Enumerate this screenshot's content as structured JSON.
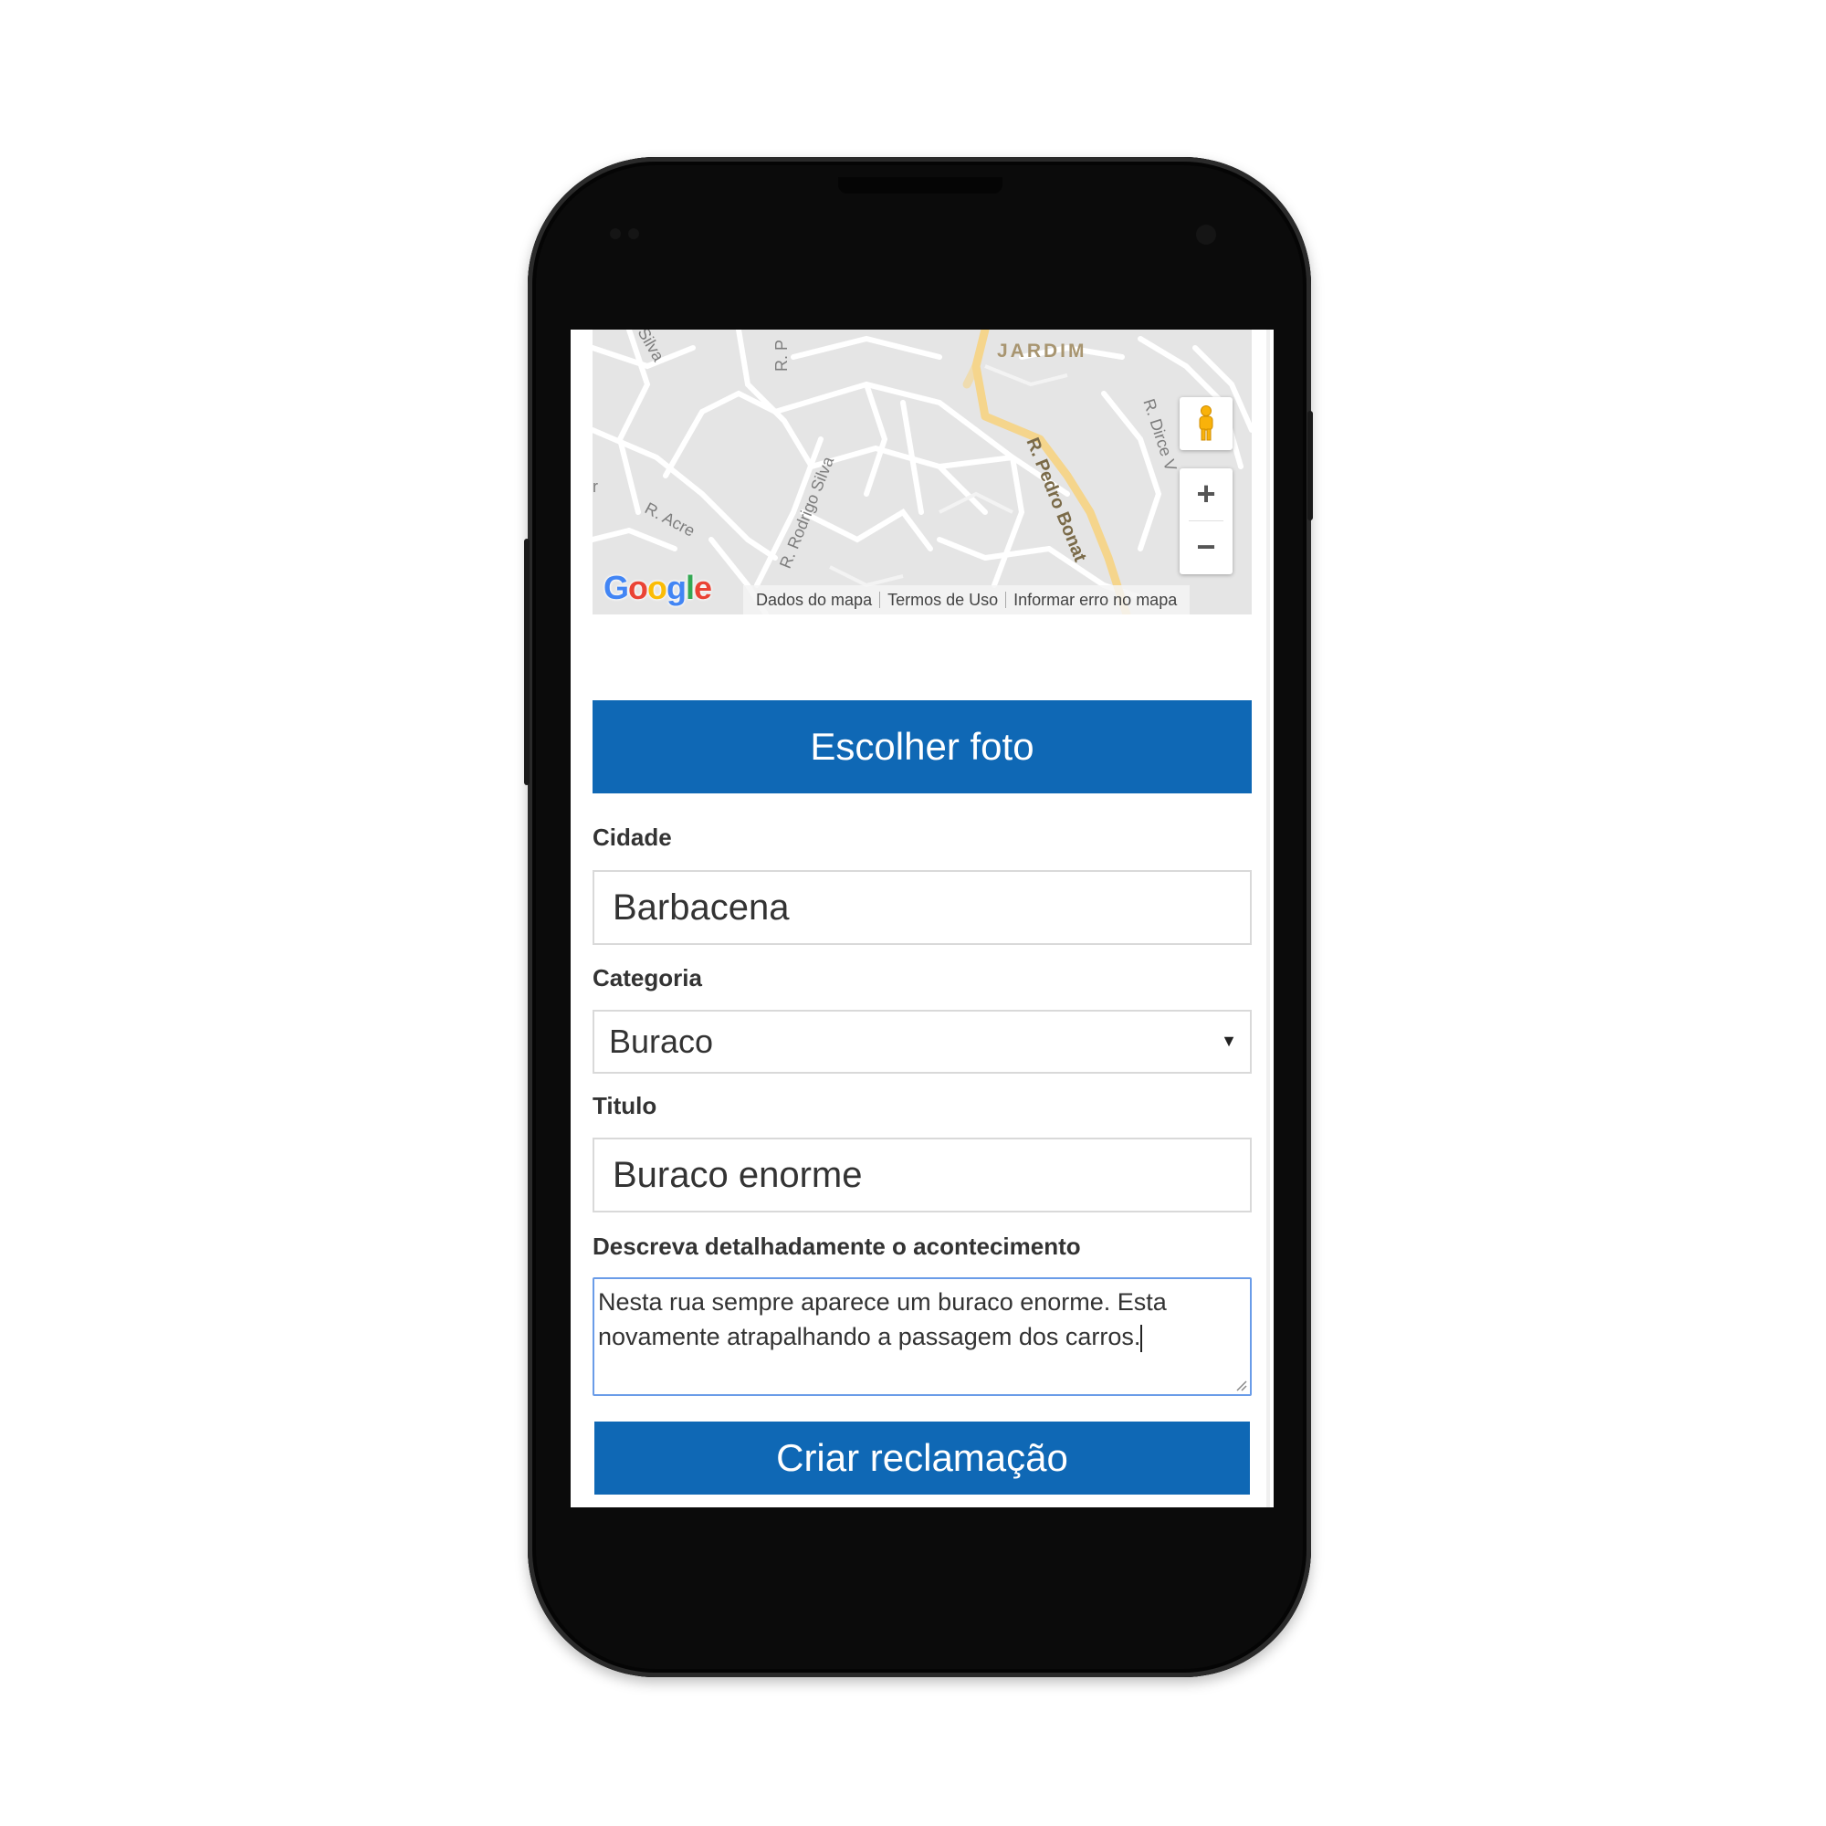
{
  "map": {
    "labels": {
      "jardim": "JARDIM",
      "silva": "Silva",
      "r_p": "R. P",
      "r_dirce": "R. Dirce V",
      "r_pedro_bonat": "R. Pedro Bonat",
      "r_rodrigo_silva": "R. Rodrigo Silva",
      "r_acre": "R. Acre",
      "r_left": "r"
    },
    "pegman_icon": "pegman-icon",
    "zoom_in": "+",
    "zoom_out": "−",
    "logo": "Google",
    "attribution": {
      "map_data": "Dados do mapa",
      "terms": "Termos de Uso",
      "report": "Informar erro no mapa"
    }
  },
  "photo_button": "Escolher foto",
  "fields": {
    "city": {
      "label": "Cidade",
      "value": "Barbacena"
    },
    "category": {
      "label": "Categoria",
      "value": "Buraco"
    },
    "title": {
      "label": "Titulo",
      "value": "Buraco enorme"
    },
    "description": {
      "label": "Descreva detalhadamente o acontecimento",
      "line1": "Nesta rua sempre aparece um buraco enorme. Esta",
      "line2": "novamente atrapalhando a passagem dos carros."
    }
  },
  "submit_button": "Criar reclamação",
  "colors": {
    "primary": "#0f68b5",
    "focus_border": "#6a9ce8",
    "map_bg": "#e5e5e5",
    "main_road": "#f5d58c"
  }
}
